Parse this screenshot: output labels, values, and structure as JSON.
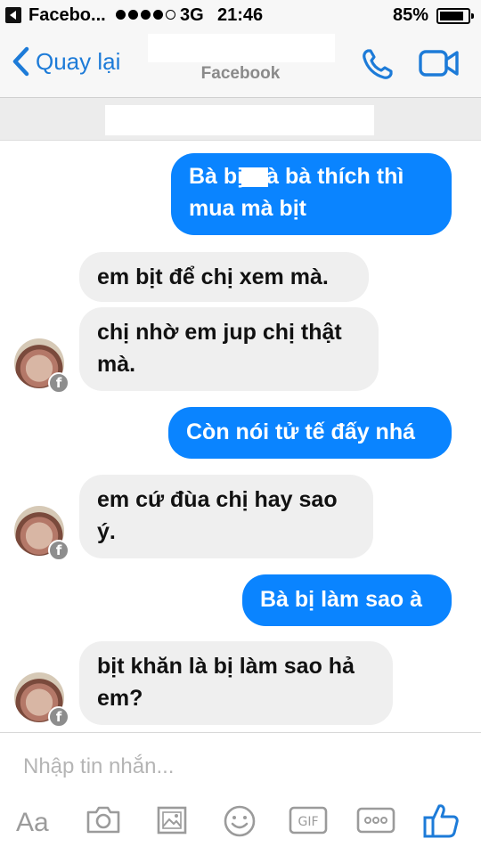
{
  "status_bar": {
    "app_name": "Facebo...",
    "network": "3G",
    "time": "21:46",
    "battery": "85%",
    "battery_level": 0.85,
    "signal_bars_on": 4,
    "signal_bars_total": 5
  },
  "nav": {
    "back_label": "Quay lại",
    "subtitle": "Facebook",
    "icons": [
      "chevron-left-icon",
      "phone-icon",
      "video-camera-icon"
    ],
    "accent_color": "#1d7bd8"
  },
  "messages": [
    {
      "direction": "out",
      "lines": [
        "Bà bị",
        "à bà thích thì",
        "mua mà bịt"
      ]
    },
    {
      "direction": "in",
      "text": "em bịt để chị xem mà."
    },
    {
      "direction": "in",
      "lines": [
        "chị nhờ em jup chị thật",
        "mà."
      ]
    },
    {
      "direction": "out",
      "text": "Còn nói tử tế đấy nhá"
    },
    {
      "direction": "in",
      "lines": [
        "em cứ đùa chị hay sao",
        "ý."
      ]
    },
    {
      "direction": "out",
      "text": "Bà bị làm sao à"
    },
    {
      "direction": "in",
      "lines": [
        "bịt khăn là bị làm sao hả",
        "em?"
      ]
    }
  ],
  "colors": {
    "outgoing_bubble": "#0a84ff",
    "incoming_bubble": "#efefef"
  },
  "composer": {
    "placeholder": "Nhập tin nhắn...",
    "tools": {
      "aa_label": "Aa",
      "gif_label": "GIF",
      "icons": [
        "text-format-icon",
        "camera-icon",
        "gallery-icon",
        "emoji-icon",
        "gif-icon",
        "more-icon",
        "like-icon"
      ]
    }
  }
}
